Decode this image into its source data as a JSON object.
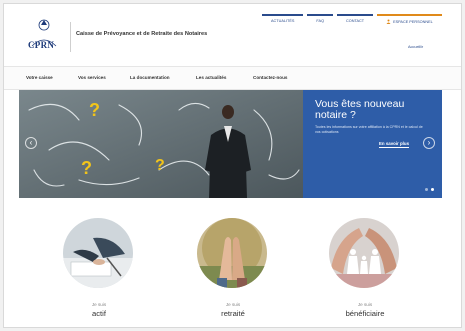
{
  "header": {
    "logo_text": "CPRN",
    "site_title": "Caisse de Prévoyance et de Retraite des Notaires",
    "top_links": [
      "ACTUALITÉS",
      "FAQ",
      "CONTACT"
    ],
    "personal_space": "ESPACE PERSONNEL",
    "login": "Accueillir"
  },
  "nav": {
    "items": [
      "Votre caisse",
      "Vos services",
      "La documentation",
      "Les actualités",
      "Contactez-nous"
    ]
  },
  "hero": {
    "title": "Vous êtes nouveau notaire ?",
    "text": "Toutes les informations sur votre affiliation à la CPRN et le calcul de vos cotisations",
    "more": "En savoir plus",
    "prev": "‹",
    "next": "›"
  },
  "profiles": [
    {
      "kicker": "Je suis",
      "label": "actif"
    },
    {
      "kicker": "Je suis",
      "label": "retraité"
    },
    {
      "kicker": "Je suis",
      "label": "bénéficiaire"
    }
  ],
  "colors": {
    "brand_blue": "#2e5da8",
    "accent_orange": "#e08a1a",
    "question_mark": "#f2c41a"
  }
}
